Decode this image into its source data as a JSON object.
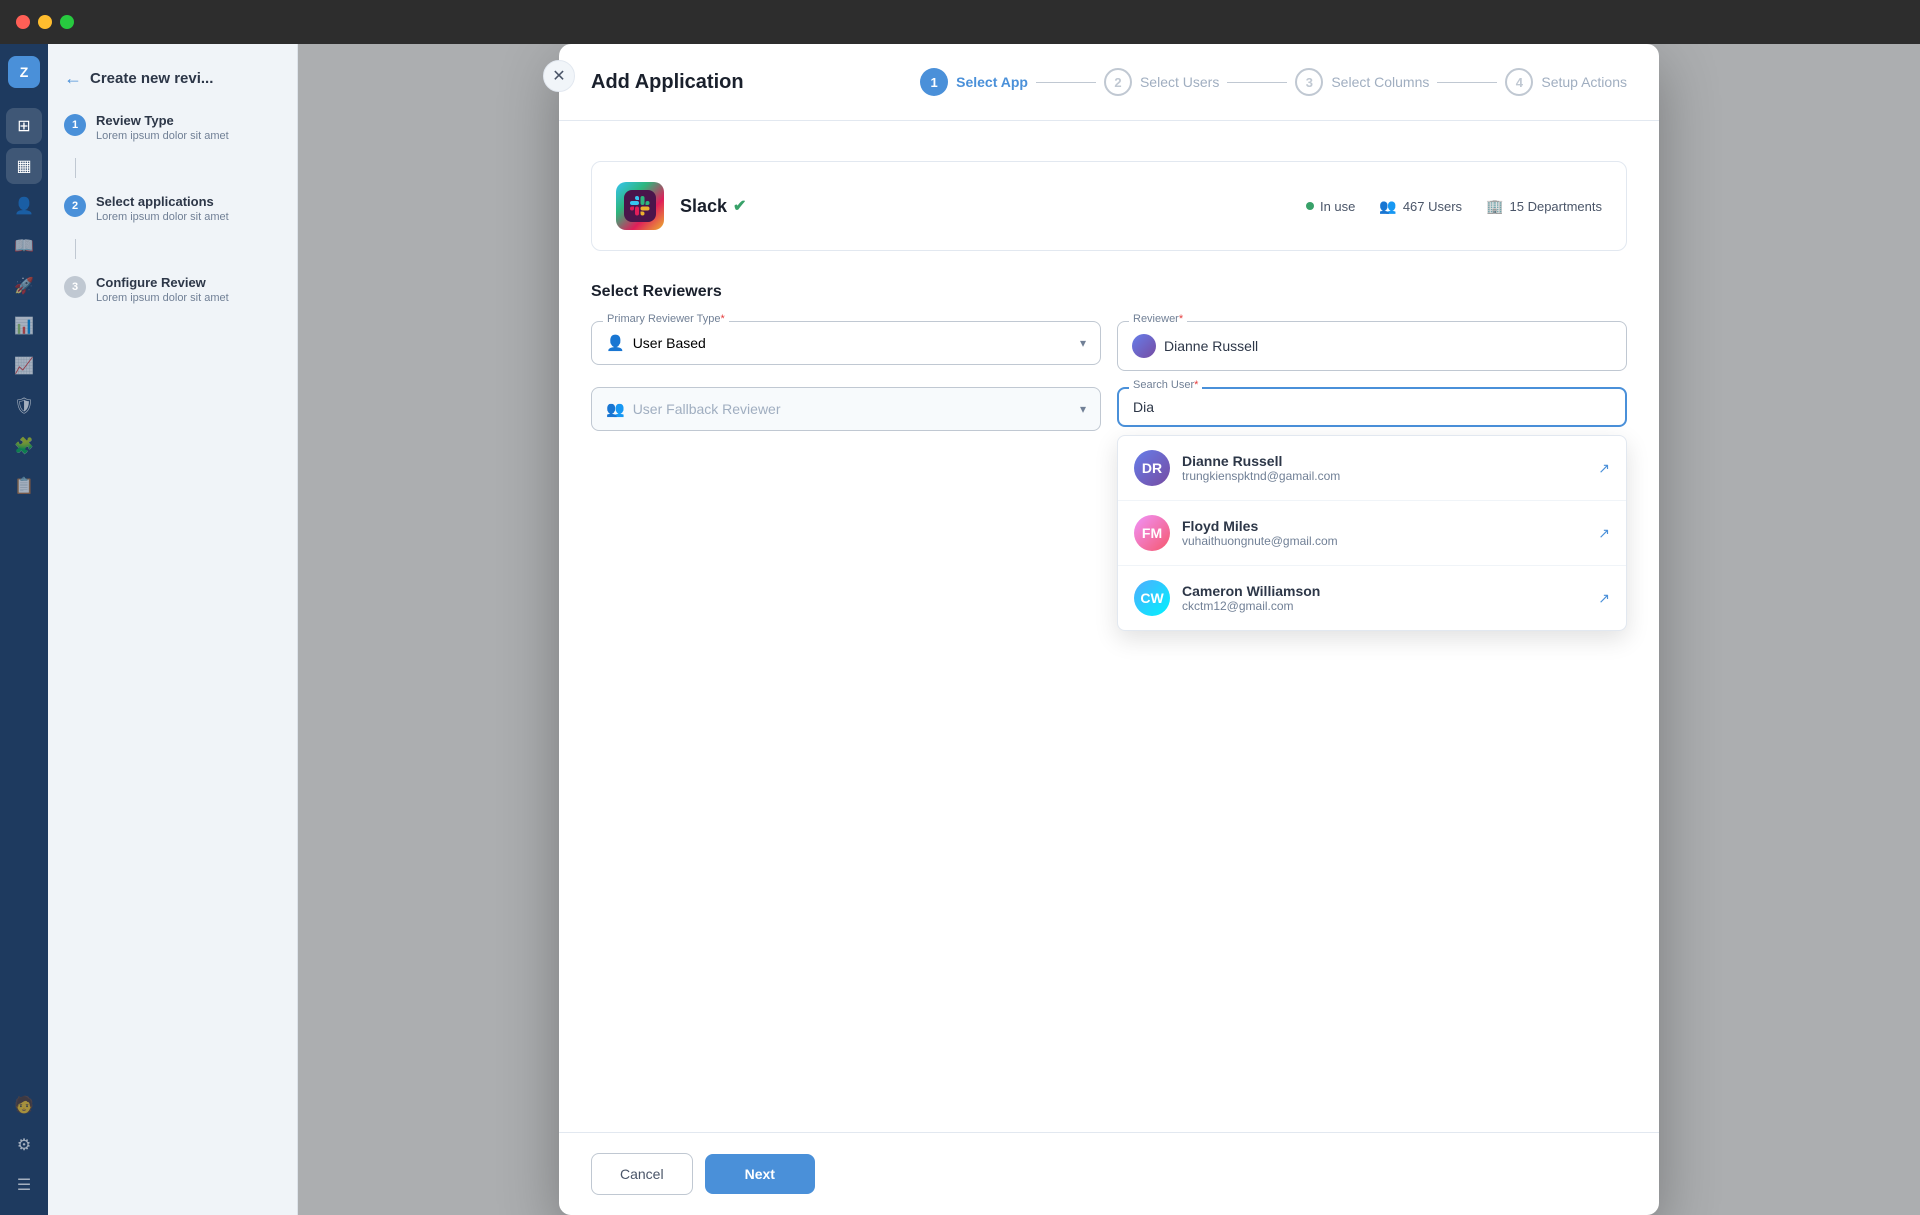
{
  "window": {
    "traffic_lights": [
      "red",
      "yellow",
      "green"
    ]
  },
  "nav_sidebar": {
    "logo": "Z",
    "icons": [
      "grid",
      "calendar",
      "user",
      "book",
      "rocket",
      "chart",
      "bar-chart",
      "shield",
      "puzzle",
      "clipboard"
    ],
    "bottom_icons": [
      "avatar",
      "settings",
      "menu"
    ]
  },
  "content_sidebar": {
    "back_label": "←",
    "title": "Create new revi...",
    "steps": [
      {
        "number": "1",
        "label": "Review Type",
        "desc": "Lorem ipsum dolor sit amet",
        "status": "active"
      },
      {
        "number": "2",
        "label": "Select applications",
        "desc": "Lorem ipsum dolor sit amet",
        "status": "active"
      },
      {
        "number": "3",
        "label": "Configure Review",
        "desc": "Lorem ipsum dolor sit amet",
        "status": "inactive"
      }
    ]
  },
  "modal": {
    "title": "Add Application",
    "close_label": "✕",
    "stepper": {
      "steps": [
        {
          "number": "1",
          "label": "Select App",
          "status": "active"
        },
        {
          "number": "2",
          "label": "Select Users",
          "status": "inactive"
        },
        {
          "number": "3",
          "label": "Select Columns",
          "status": "inactive"
        },
        {
          "number": "4",
          "label": "Setup Actions",
          "status": "inactive"
        }
      ]
    },
    "app_card": {
      "name": "Slack",
      "verified": "✓",
      "status": "In use",
      "users": "467 Users",
      "departments": "15 Departments"
    },
    "reviewers_section": {
      "title": "Select Reviewers",
      "primary_reviewer_label": "Primary Reviewer Type",
      "primary_reviewer_value": "User Based",
      "fallback_label": "User Fallback Reviewer",
      "reviewer_label": "Reviewer",
      "reviewer_value": "Dianne Russell",
      "search_label": "Search User",
      "search_value": "Dia",
      "dropdown_items": [
        {
          "name": "Dianne Russell",
          "email": "trungkienspktnd@gamail.com",
          "initials": "DR"
        },
        {
          "name": "Floyd Miles",
          "email": "vuhaithuongnute@gmail.com",
          "initials": "FM"
        },
        {
          "name": "Cameron Williamson",
          "email": "ckctm12@gmail.com",
          "initials": "CW"
        }
      ]
    },
    "footer": {
      "cancel_label": "Cancel",
      "next_label": "Next"
    }
  }
}
